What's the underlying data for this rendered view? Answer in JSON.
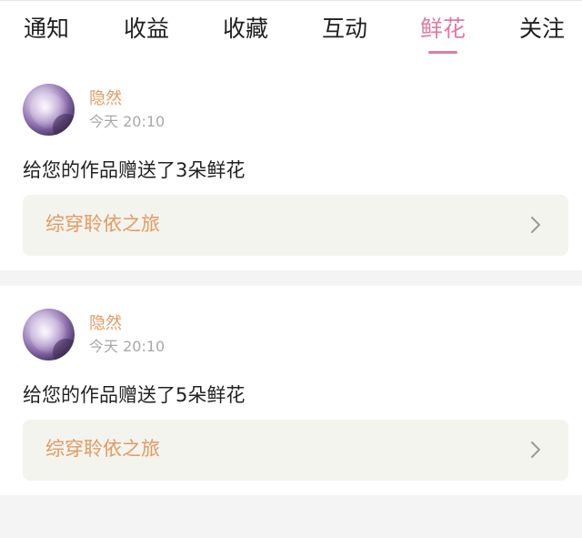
{
  "tabs": [
    {
      "label": "通知",
      "active": false
    },
    {
      "label": "收益",
      "active": false
    },
    {
      "label": "收藏",
      "active": false
    },
    {
      "label": "互动",
      "active": false
    },
    {
      "label": "鲜花",
      "active": true
    },
    {
      "label": "关注",
      "active": false
    }
  ],
  "colors": {
    "accent_pink": "#e07aa5",
    "accent_orange": "#e39a62",
    "muted_text": "#a8a8a8",
    "book_bar_bg": "#f4f4ef"
  },
  "notifications": [
    {
      "username": "隐然",
      "time": "今天 20:10",
      "message": "给您的作品赠送了3朵鲜花",
      "book_title": "综穿聆依之旅",
      "avatar_icon": "avatar-image",
      "chevron_icon": "chevron-right-icon"
    },
    {
      "username": "隐然",
      "time": "今天 20:10",
      "message": "给您的作品赠送了5朵鲜花",
      "book_title": "综穿聆依之旅",
      "avatar_icon": "avatar-image",
      "chevron_icon": "chevron-right-icon"
    }
  ]
}
